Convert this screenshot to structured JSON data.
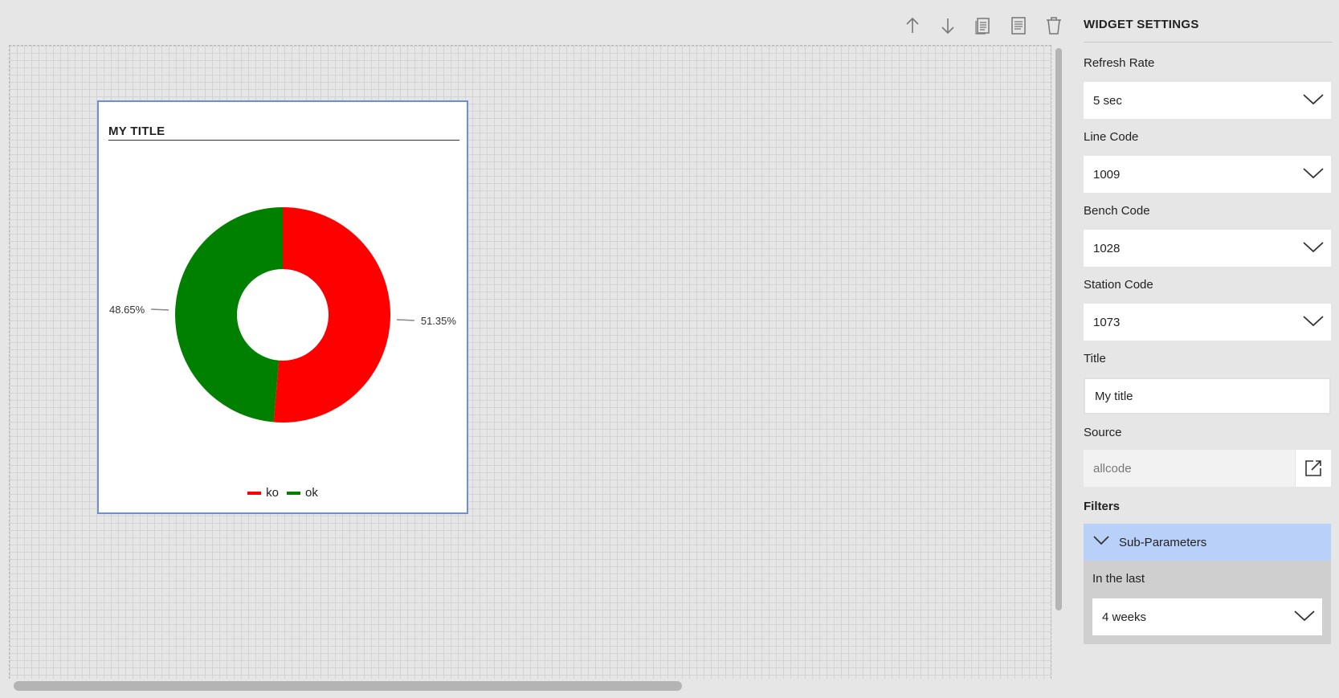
{
  "toolbar": {
    "buttons": [
      {
        "icon": "arrow-up-icon"
      },
      {
        "icon": "arrow-down-icon"
      },
      {
        "icon": "duplicate-icon"
      },
      {
        "icon": "document-icon"
      },
      {
        "icon": "trash-icon"
      }
    ]
  },
  "widget": {
    "title": "MY TITLE",
    "chart_data": {
      "type": "pie",
      "donut": true,
      "categories": [
        "ko",
        "ok"
      ],
      "values": [
        51.35,
        48.65
      ],
      "labels": [
        "51.35%",
        "48.65%"
      ],
      "colors": [
        "#ff0000",
        "#008000"
      ],
      "legend_position": "bottom"
    }
  },
  "settings": {
    "header": "WIDGET SETTINGS",
    "refresh_rate": {
      "label": "Refresh Rate",
      "value": "5 sec"
    },
    "line_code": {
      "label": "Line Code",
      "value": "1009"
    },
    "bench_code": {
      "label": "Bench Code",
      "value": "1028"
    },
    "station_code": {
      "label": "Station Code",
      "value": "1073"
    },
    "title": {
      "label": "Title",
      "value": "My title"
    },
    "source": {
      "label": "Source",
      "value": "allcode"
    },
    "filters": {
      "label": "Filters",
      "subparams": {
        "label": "Sub-Parameters",
        "in_the_last": {
          "label": "In the last",
          "value": "4 weeks"
        }
      }
    }
  }
}
